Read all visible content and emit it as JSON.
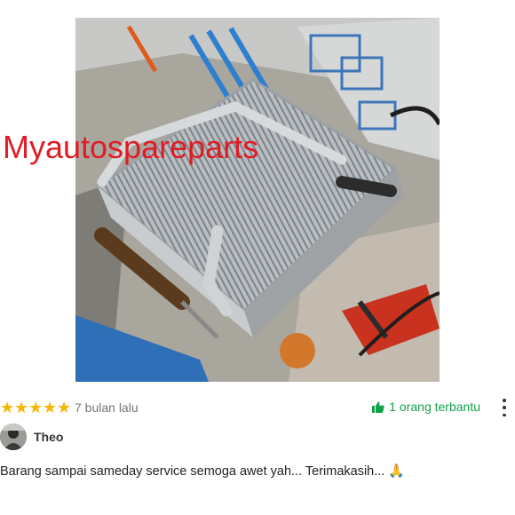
{
  "photo": {
    "watermark": "Myautospareparts",
    "content_icon": "evaporator-photo"
  },
  "review": {
    "rating": 5,
    "rating_max": 5,
    "star_color": "#f5b800",
    "time_ago": "7 bulan lalu",
    "helpful_label": "1 orang terbantu",
    "helpful_color": "#12a14a",
    "helpful_icon": "thumbs-up-icon",
    "menu_icon": "more-vertical-icon",
    "user": {
      "name": "Theo",
      "avatar_icon": "avatar"
    },
    "comment": "Barang sampai sameday service semoga awet yah... Terimakasih...",
    "comment_emoji": "🙏"
  }
}
